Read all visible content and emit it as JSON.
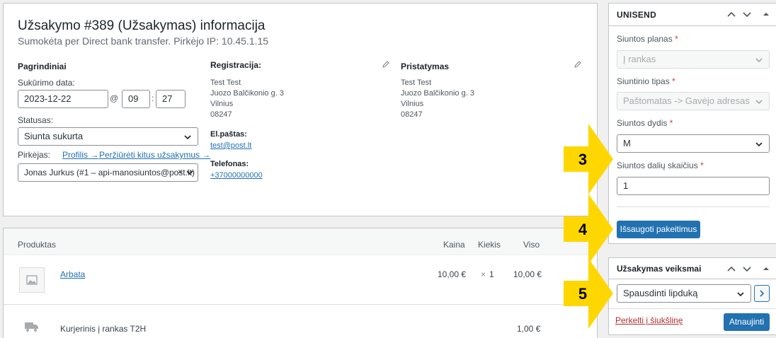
{
  "order": {
    "title": "Užsakymo #389 (Užsakymas) informacija",
    "subtitle": "Sumokėta per Direct bank transfer. Pirkėjo IP: 10.45.1.15"
  },
  "general": {
    "heading": "Pagrindiniai",
    "created_label": "Sukūrimo data:",
    "date": "2023-12-22",
    "at": "@",
    "hour": "09",
    "colon": ":",
    "minute": "27",
    "status_label": "Statusas:",
    "status_value": "Siunta sukurta",
    "customer_label": "Pirkėjas:",
    "profile_link": "Profilis →",
    "other_orders_link": "Peržiūrėti kitus užsakymus →",
    "customer_value": "Jonas Jurkus (#1 – api-manosiuntos@post.lt)",
    "clear_icon": "×"
  },
  "billing": {
    "heading": "Registracija:",
    "name": "Test Test",
    "street": "Juozo Balčikonio g. 3",
    "city": "Vilnius",
    "postcode": "08247",
    "email_label": "El.paštas:",
    "email": "test@post.lt",
    "phone_label": "Telefonas:",
    "phone": "+37000000000"
  },
  "shipping": {
    "heading": "Pristatymas",
    "name": "Test Test",
    "street": "Juozo Balčikonio g. 3",
    "city": "Vilnius",
    "postcode": "08247"
  },
  "items": {
    "headers": {
      "product": "Produktas",
      "price": "Kaina",
      "qty": "Kiekis",
      "total": "Viso"
    },
    "rows": [
      {
        "name": "Arbata",
        "price": "10,00 €",
        "qty_mark": "×",
        "qty": "1",
        "total": "10,00 €"
      }
    ],
    "shipping_row": {
      "name": "Kurjerinis į rankas T2H",
      "total": "1,00 €"
    }
  },
  "unisend": {
    "title": "UNISEND",
    "plan_label": "Siuntos planas",
    "plan_value": "Į rankas",
    "type_label": "Siuntinio tipas",
    "type_value": "Paštomatas -> Gavėjo adresas",
    "size_label": "Siuntos dydis",
    "size_value": "M",
    "parts_label": "Siuntos dalių skaičius",
    "parts_value": "1",
    "required_mark": "*",
    "save_button": "Išsaugoti pakeitimus"
  },
  "actions": {
    "title": "Užsakymas veiksmai",
    "select_value": "Spausdinti lipduką",
    "trash_link": "Perkelti į šiukšlinę",
    "update_button": "Atnaujinti"
  },
  "callouts": [
    {
      "number": "3"
    },
    {
      "number": "4"
    },
    {
      "number": "5"
    }
  ],
  "colors": {
    "accent": "#2271b1",
    "callout": "#ffd700",
    "danger": "#b32d2e"
  }
}
